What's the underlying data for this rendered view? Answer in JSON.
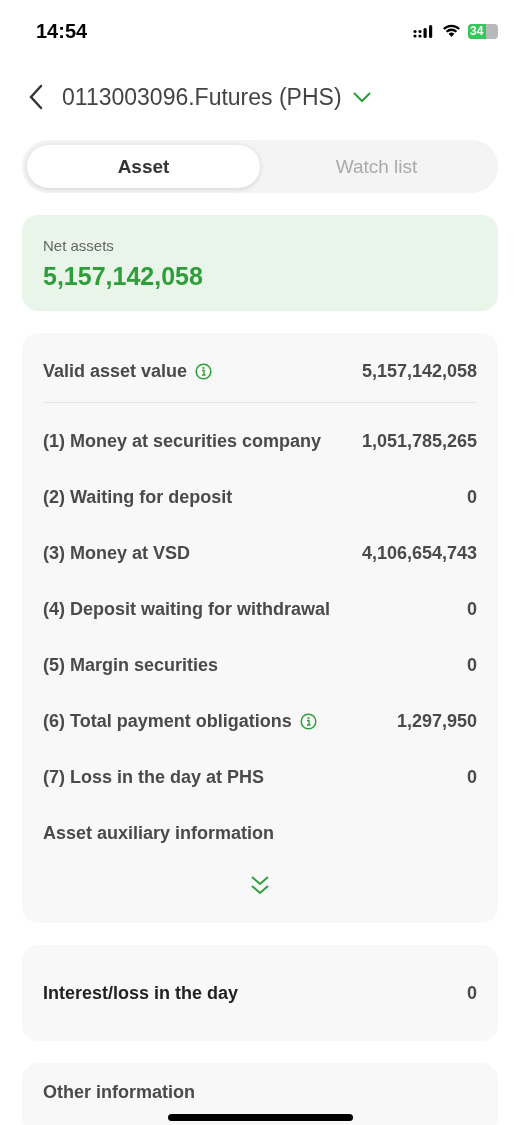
{
  "status_bar": {
    "time": "14:54",
    "battery": "34"
  },
  "header": {
    "title": "0113003096.Futures (PHS)"
  },
  "tabs": [
    {
      "label": "Asset",
      "selected": true
    },
    {
      "label": "Watch list",
      "selected": false
    }
  ],
  "net_assets": {
    "label": "Net assets",
    "value": "5,157,142,058"
  },
  "asset_card": {
    "summary": {
      "label": "Valid asset value",
      "value": "5,157,142,058",
      "info": true
    },
    "rows": [
      {
        "label": "(1) Money at securities company",
        "value": "1,051,785,265",
        "info": false
      },
      {
        "label": "(2) Waiting for deposit",
        "value": "0",
        "info": false
      },
      {
        "label": "(3) Money at VSD",
        "value": "4,106,654,743",
        "info": false
      },
      {
        "label": "(4) Deposit waiting for withdrawal",
        "value": "0",
        "info": false
      },
      {
        "label": "(5) Margin securities",
        "value": "0",
        "info": false
      },
      {
        "label": "(6) Total payment obligations",
        "value": "1,297,950",
        "info": true
      },
      {
        "label": "(7) Loss in the day at PHS",
        "value": "0",
        "info": false
      }
    ],
    "auxiliary": {
      "label": "Asset auxiliary information",
      "expanded": false
    }
  },
  "interest_card": {
    "label": "Interest/loss in the day",
    "value": "0"
  },
  "other_card": {
    "label": "Other information"
  }
}
